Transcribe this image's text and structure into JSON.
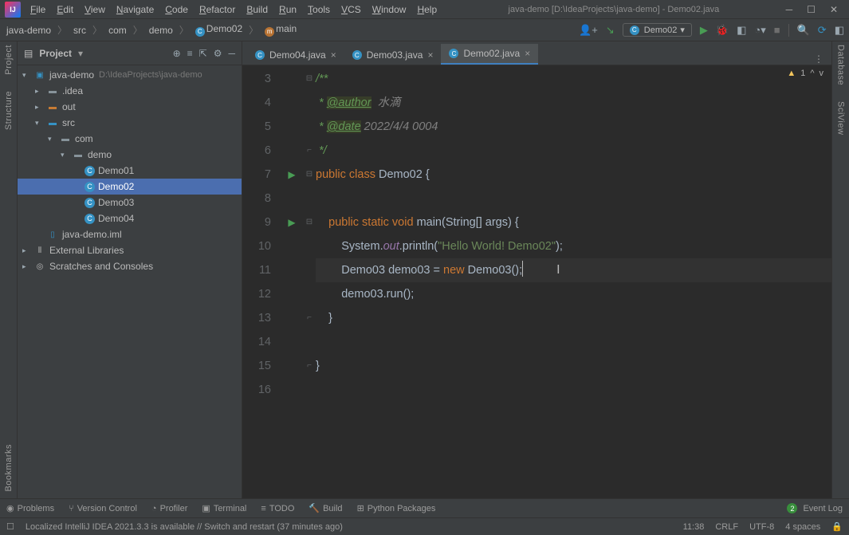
{
  "window": {
    "title": "java-demo [D:\\IdeaProjects\\java-demo] - Demo02.java"
  },
  "menus": [
    "File",
    "Edit",
    "View",
    "Navigate",
    "Code",
    "Refactor",
    "Build",
    "Run",
    "Tools",
    "VCS",
    "Window",
    "Help"
  ],
  "breadcrumb": {
    "project": "java-demo",
    "src": "src",
    "pkg1": "com",
    "pkg2": "demo",
    "cls": "Demo02",
    "method": "main"
  },
  "runConfig": "Demo02",
  "projectPanel": {
    "title": "Project",
    "root": "java-demo",
    "rootPath": "D:\\IdeaProjects\\java-demo",
    "idea": ".idea",
    "out": "out",
    "src": "src",
    "com": "com",
    "demo": "demo",
    "files": [
      "Demo01",
      "Demo02",
      "Demo03",
      "Demo04"
    ],
    "iml": "java-demo.iml",
    "extLib": "External Libraries",
    "scratches": "Scratches and Consoles"
  },
  "tabs": [
    {
      "label": "Demo04.java",
      "active": false
    },
    {
      "label": "Demo03.java",
      "active": false
    },
    {
      "label": "Demo02.java",
      "active": true
    }
  ],
  "code": {
    "startLine": 3,
    "lines": [
      {
        "n": 3,
        "html": "<span class='doc'>/**</span>"
      },
      {
        "n": 4,
        "html": "<span class='doc'> * </span><span class='doctag'>@author</span><span class='cmt'>  水滴</span>"
      },
      {
        "n": 5,
        "html": "<span class='doc'> * </span><span class='doctag'>@date</span><span class='cmt'> 2022/4/4 0004</span>"
      },
      {
        "n": 6,
        "html": "<span class='doc'> */</span>"
      },
      {
        "n": 7,
        "run": true,
        "html": "<span class='kw'>public</span> <span class='kw'>class</span> <span class='cls'>Demo02</span> <span class='id'>{</span>"
      },
      {
        "n": 8,
        "html": ""
      },
      {
        "n": 9,
        "run": true,
        "html": "    <span class='kw'>public</span> <span class='kw'>static</span> <span class='kw'>void</span> <span class='id'>main(String[] args) {</span>"
      },
      {
        "n": 10,
        "html": "        <span class='id'>System.</span><span class='fld'>out</span><span class='id'>.println(</span><span class='str'>\"Hello World! Demo02\"</span><span class='id'>);</span>"
      },
      {
        "n": 11,
        "cur": true,
        "html": "        <span class='id'>Demo03 demo03 = </span><span class='kw'>new</span> <span class='id'>Demo03();</span><span class='caret'></span><span class='textcur'>I</span>"
      },
      {
        "n": 12,
        "html": "        <span class='id'>demo03.run();</span>"
      },
      {
        "n": 13,
        "html": "    <span class='id'>}</span>"
      },
      {
        "n": 14,
        "html": ""
      },
      {
        "n": 15,
        "html": "<span class='id'>}</span>"
      },
      {
        "n": 16,
        "html": ""
      }
    ],
    "warnCount": "1"
  },
  "leftTabs": [
    "Project",
    "Structure",
    "Bookmarks"
  ],
  "rightTabs": [
    "Database",
    "SciView"
  ],
  "bottomTools": [
    "Problems",
    "Version Control",
    "Profiler",
    "Terminal",
    "TODO",
    "Build",
    "Python Packages"
  ],
  "eventLog": "Event Log",
  "status": {
    "msg": "Localized IntelliJ IDEA 2021.3.3 is available // Switch and restart (37 minutes ago)",
    "time": "11:38",
    "le": "CRLF",
    "enc": "UTF-8",
    "indent": "4 spaces"
  }
}
